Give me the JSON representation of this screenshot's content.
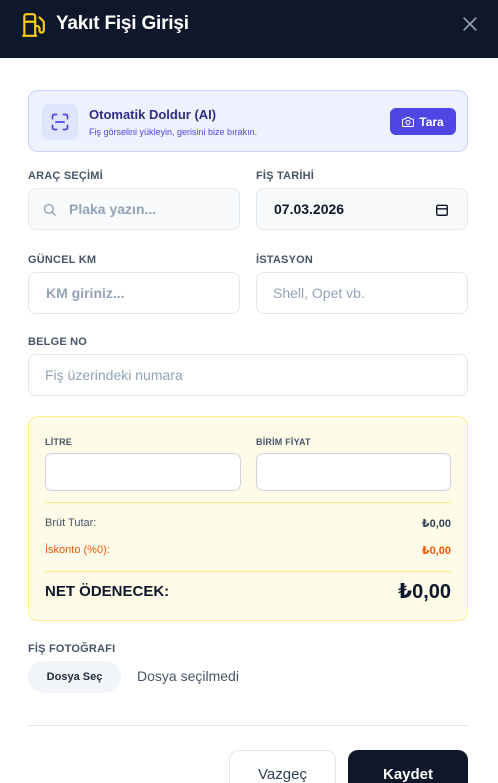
{
  "header": {
    "title": "Yakıt Fişi Girişi",
    "icon": "fuel-pump-icon",
    "close_icon": "close-icon",
    "bg_color": "#0f172a",
    "icon_color": "#facc15"
  },
  "autofill": {
    "title": "Otomatik Doldur (AI)",
    "subtitle": "Fiş görselini yükleyin, gerisini bize bırakın.",
    "scan_label": "Tara",
    "icon": "scan-icon",
    "button_icon": "camera-icon",
    "accent_color": "#4f46e5"
  },
  "form": {
    "vehicle": {
      "label": "ARAÇ SEÇİMİ",
      "placeholder": "Plaka yazın..."
    },
    "receipt_date": {
      "label": "FİŞ TARİHİ",
      "value": "07.03.2026"
    },
    "current_km": {
      "label": "GÜNCEL KM",
      "placeholder": "KM giriniz..."
    },
    "station": {
      "label": "İSTASYON",
      "placeholder": "Shell, Opet vb."
    },
    "document_no": {
      "label": "BELGE NO",
      "placeholder": "Fiş üzerindeki numara"
    }
  },
  "calculation": {
    "liters_label": "LİTRE",
    "unit_price_label": "BİRİM FİYAT",
    "gross_label": "Brüt Tutar:",
    "gross_value": "₺0,00",
    "discount_label": "İskonto (%0):",
    "discount_value": "₺0,00",
    "net_label": "NET ÖDENECEK:",
    "net_value": "₺0,00",
    "discount_color": "#ea580c"
  },
  "photo": {
    "label": "FİŞ FOTOĞRAFI",
    "choose_label": "Dosya Seç",
    "status": "Dosya seçilmedi"
  },
  "actions": {
    "cancel_label": "Vazgeç",
    "save_label": "Kaydet"
  }
}
